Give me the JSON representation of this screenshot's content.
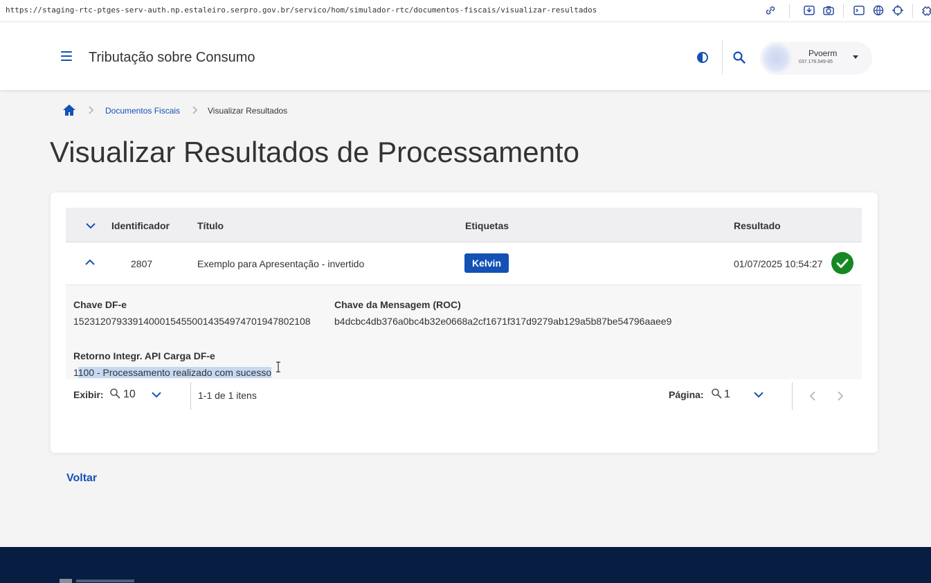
{
  "browser": {
    "url": "https://staging-rtc-ptges-serv-auth.np.estaleiro.serpro.gov.br/servico/hom/simulador-rtc/documentos-fiscais/visualizar-resultados"
  },
  "header": {
    "app_title": "Tributação sobre Consumo",
    "user": {
      "name": "Pvoerm",
      "document": "037.176.549-85"
    }
  },
  "breadcrumb": {
    "link": "Documentos Fiscais",
    "current": "Visualizar Resultados"
  },
  "page_title": "Visualizar Resultados de Processamento",
  "table": {
    "columns": [
      "Identificador",
      "Título",
      "Etiquetas",
      "Resultado"
    ],
    "row": {
      "id": "2807",
      "title": "Exemplo para Apresentação - invertido",
      "tag": "Kelvin",
      "result": "01/07/2025 10:54:27",
      "status_color": "#168821"
    },
    "detail": {
      "chave_label": "Chave DF-e",
      "chave_value": "15231207933914000154550014354974701947802108",
      "msg_label": "Chave da Mensagem (ROC)",
      "msg_value": "b4dcbc4db376a0bc4b32e0668a2cf1671f317d9279ab129a5b87be54796aaee9",
      "retorno_label": "Retorno Integr. API Carga DF-e",
      "retorno_prefix": "1",
      "retorno_highlight": "100 - Processamento realizado com sucesso"
    }
  },
  "pagination": {
    "show_label": "Exibir:",
    "per_page": "10",
    "range": "1-1 de 1 itens",
    "page_label": "Página:",
    "page": "1"
  },
  "actions": {
    "back": "Voltar"
  },
  "colors": {
    "primary": "#1351b4",
    "footer": "#071d41",
    "success": "#168821"
  }
}
